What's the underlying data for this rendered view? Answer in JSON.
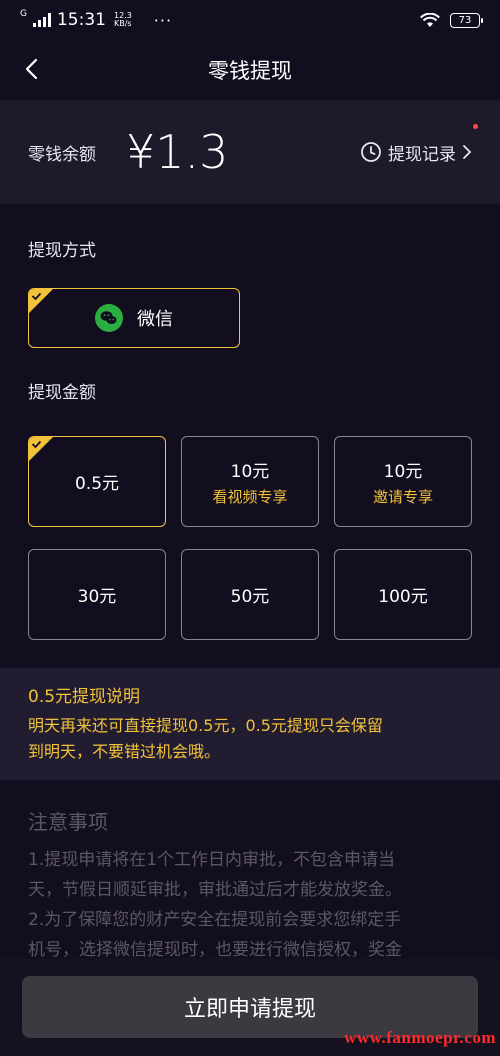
{
  "status_bar": {
    "carrier": "G",
    "time": "15:31",
    "net_speed_value": "12.3",
    "net_speed_unit": "KB/s",
    "more": "···",
    "battery": "73"
  },
  "nav": {
    "title": "零钱提现"
  },
  "balance": {
    "label": "零钱余额",
    "amount": "¥1.3",
    "record_link": "提现记录"
  },
  "method": {
    "title": "提现方式",
    "options": [
      {
        "label": "微信",
        "selected": true
      }
    ]
  },
  "amount": {
    "title": "提现金额",
    "options": [
      {
        "value": "0.5元",
        "sub": "",
        "selected": true
      },
      {
        "value": "10元",
        "sub": "看视频专享",
        "selected": false
      },
      {
        "value": "10元",
        "sub": "邀请专享",
        "selected": false
      },
      {
        "value": "30元",
        "sub": "",
        "selected": false
      },
      {
        "value": "50元",
        "sub": "",
        "selected": false
      },
      {
        "value": "100元",
        "sub": "",
        "selected": false
      }
    ]
  },
  "explain": {
    "title": "0.5元提现说明",
    "line1": "明天再来还可直接提现0.5元，0.5元提现只会保留",
    "line2": "到明天，不要错过机会哦。"
  },
  "notes": {
    "title": "注意事项",
    "line1": "1.提现申请将在1个工作日内审批，不包含申请当",
    "line2": "天，节假日顺延审批，审批通过后才能发放奖金。",
    "line3": "2.为了保障您的财产安全在提现前会要求您绑定手",
    "line4": "机号，选择微信提现时，也要进行微信授权，奖金"
  },
  "footer": {
    "apply_label": "立即申请提现",
    "watermark": "www.fanmoepr.com"
  },
  "colors": {
    "background": "#130d20",
    "card": "#1e1a2c",
    "accent": "#f2c23a",
    "button": "#3c3a40",
    "wechat_green": "#2aae3f"
  }
}
